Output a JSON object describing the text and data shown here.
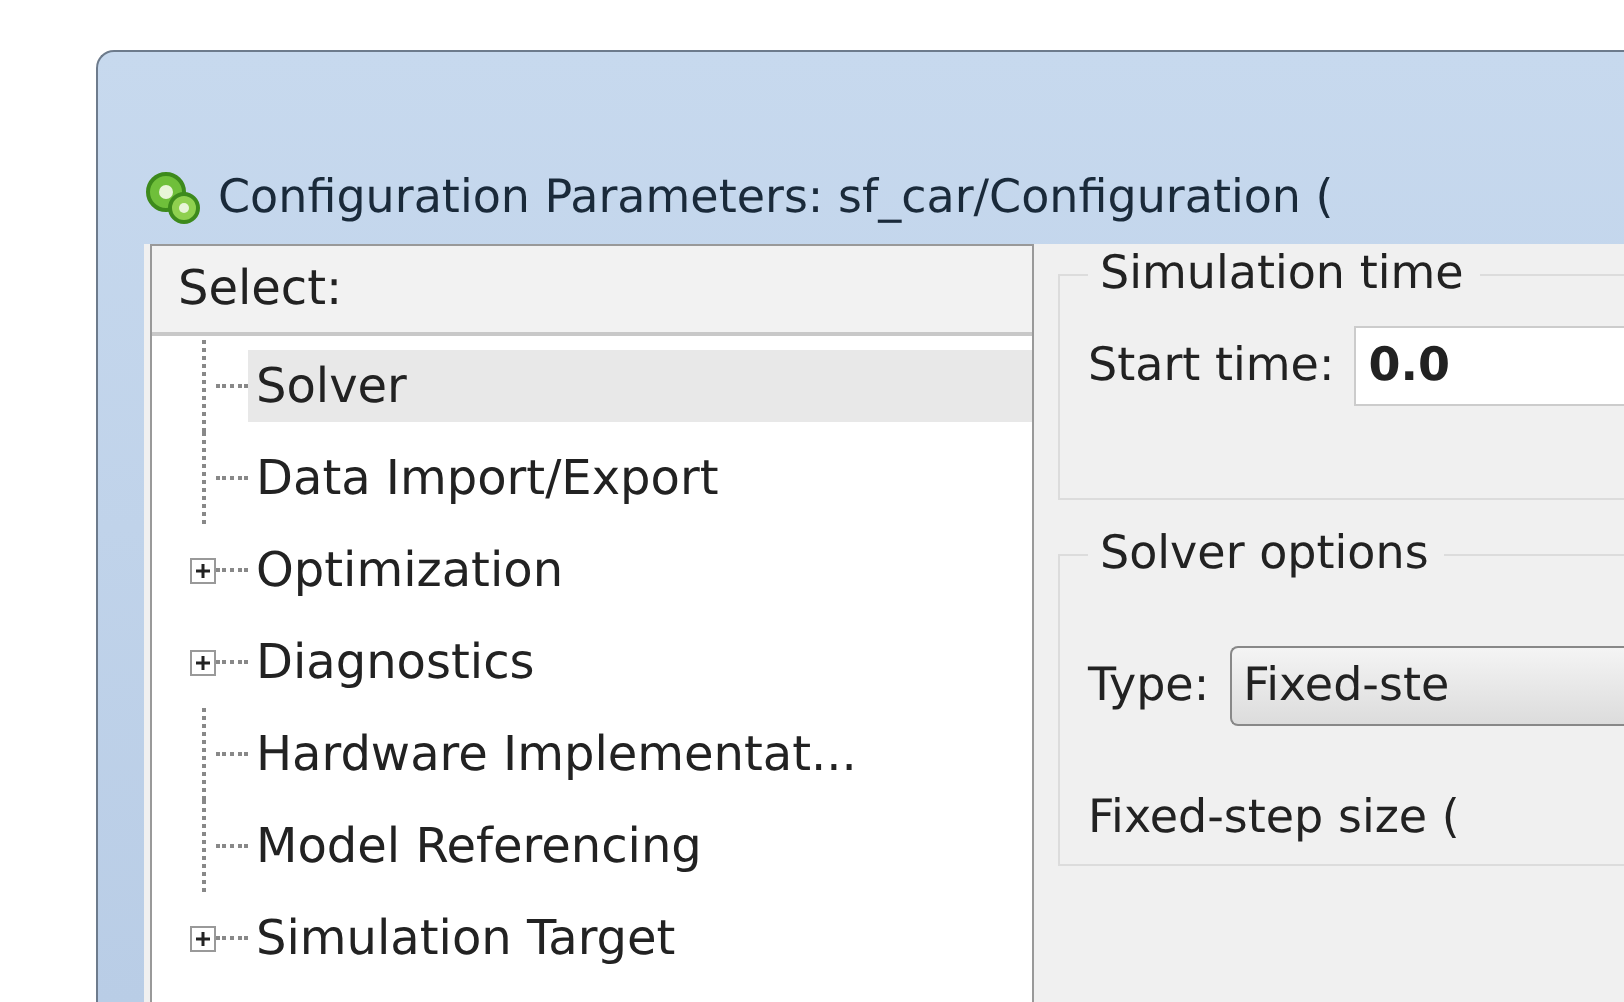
{
  "window": {
    "title": "Configuration Parameters: sf_car/Configuration ("
  },
  "tree": {
    "header": "Select:",
    "items": [
      {
        "label": "Solver",
        "expandable": false,
        "selected": true
      },
      {
        "label": "Data Import/Export",
        "expandable": false,
        "selected": false
      },
      {
        "label": "Optimization",
        "expandable": true,
        "selected": false
      },
      {
        "label": "Diagnostics",
        "expandable": true,
        "selected": false
      },
      {
        "label": "Hardware Implementat...",
        "expandable": false,
        "selected": false
      },
      {
        "label": "Model Referencing",
        "expandable": false,
        "selected": false
      },
      {
        "label": "Simulation Target",
        "expandable": true,
        "selected": false
      }
    ]
  },
  "simulation_time": {
    "title": "Simulation time",
    "start_time_label": "Start time:",
    "start_time_value": "0.0"
  },
  "solver_options": {
    "title": "Solver options",
    "type_label": "Type:",
    "type_value": "Fixed-ste",
    "step_size_label": "Fixed-step size ("
  }
}
